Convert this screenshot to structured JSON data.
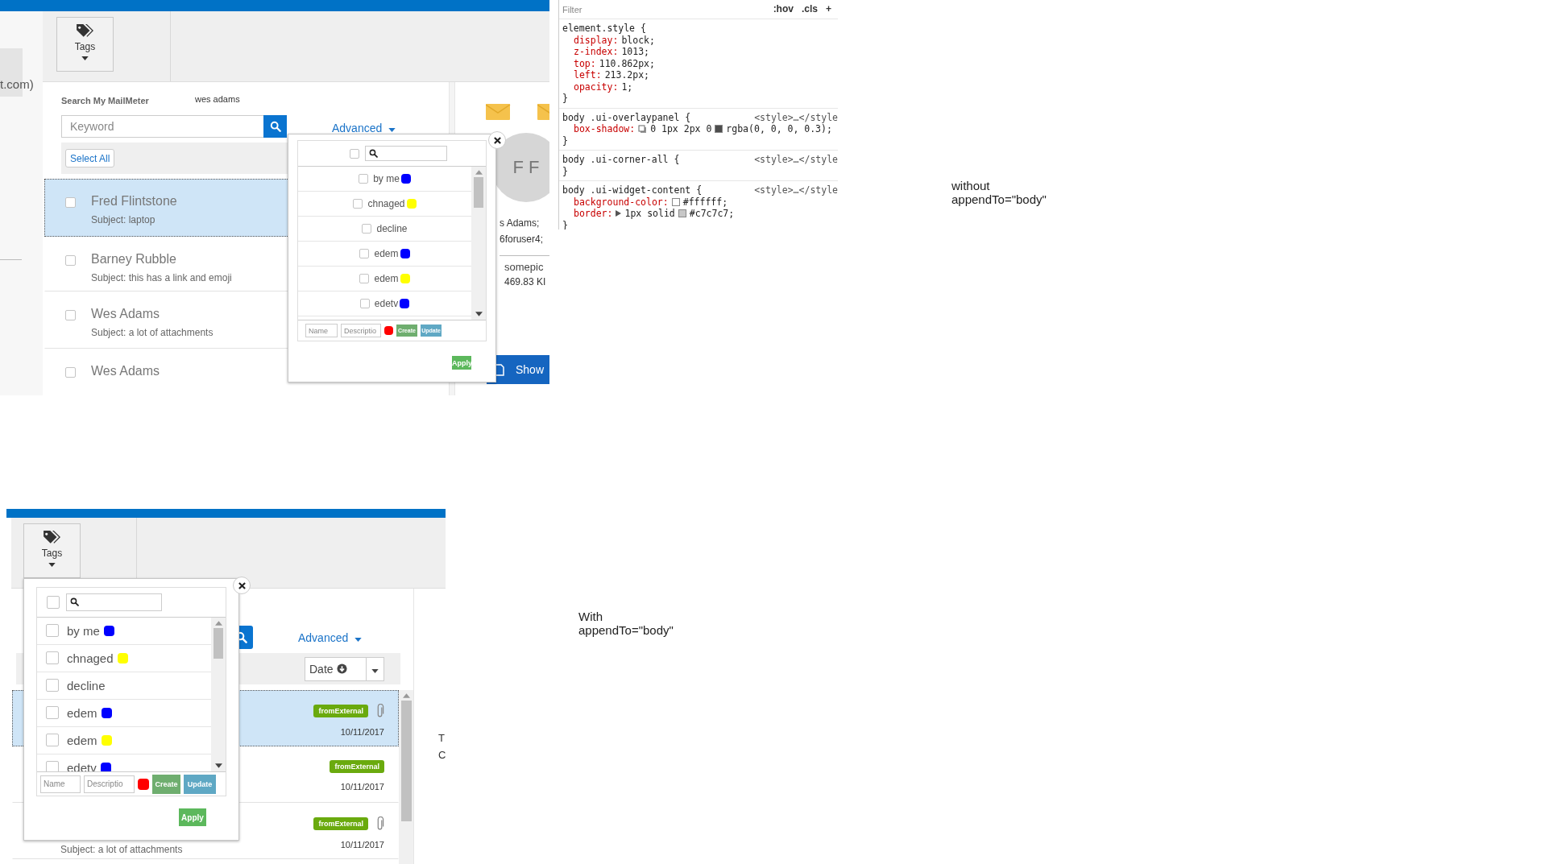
{
  "top_screenshot": {
    "left_strip": {
      "text": "t.com)"
    },
    "toolbar": {
      "tags_button": {
        "label": "Tags"
      }
    },
    "search": {
      "title": "Search My MailMeter",
      "query": "wes adams",
      "placeholder": "Keyword",
      "advanced": "Advanced",
      "select_all": "Select All"
    },
    "messages": [
      {
        "sender": "Fred Flintstone",
        "subject": "Subject: laptop",
        "selected": true,
        "checked": false
      },
      {
        "sender": "Barney Rubble",
        "subject": "Subject: this has a link and emoji",
        "selected": false,
        "checked": false
      },
      {
        "sender": "Wes Adams",
        "subject": "Subject: a lot of attachments",
        "selected": false,
        "checked": false
      },
      {
        "sender": "Wes Adams",
        "selected": false,
        "checked": false
      }
    ],
    "preview": {
      "avatar": "F F",
      "recipients": [
        "s Adams;",
        "6foruser4;"
      ],
      "attachment_name": "somepic",
      "attachment_size": "469.83 KI",
      "show_button": "Show"
    },
    "tag_popup": {
      "all_checked": false,
      "tags": [
        {
          "label": "by me",
          "color": "#0000ff",
          "checked": false
        },
        {
          "label": "chnaged",
          "color": "#ffff00",
          "checked": false
        },
        {
          "label": "decline",
          "checked": false
        },
        {
          "label": "edem",
          "color": "#0000ff",
          "checked": false
        },
        {
          "label": "edem",
          "color": "#ffff00",
          "checked": false
        },
        {
          "label": "edetv",
          "color": "#0000ff",
          "checked": false
        }
      ],
      "name_placeholder": "Name",
      "description_placeholder": "Descriptio",
      "color_picker": {
        "color": "#ff0000"
      },
      "create": {
        "label": "Create",
        "disabled": true
      },
      "update": {
        "label": "Update",
        "disabled": true
      },
      "apply": "Apply"
    }
  },
  "devtools": {
    "filter_placeholder": "Filter",
    "buttons": [
      ":hov",
      ".cls",
      "+"
    ],
    "rules": [
      {
        "selector": "element.style {",
        "declarations": [
          {
            "property": "display:",
            "value": [
              {
                "kind": "text",
                "text": "block;"
              }
            ]
          },
          {
            "property": "z-index:",
            "value": [
              {
                "kind": "text",
                "text": "1013;"
              }
            ]
          },
          {
            "property": "top:",
            "value": [
              {
                "kind": "text",
                "text": "110.862px;"
              }
            ]
          },
          {
            "property": "left:",
            "value": [
              {
                "kind": "text",
                "text": "213.2px;"
              }
            ]
          },
          {
            "property": "opacity:",
            "value": [
              {
                "kind": "text",
                "text": "1;"
              }
            ]
          }
        ],
        "close": "}"
      },
      {
        "selector": "body .ui-overlaypanel {",
        "source": "<style>…</style",
        "declarations": [
          {
            "property": "box-shadow:",
            "value": [
              {
                "kind": "shadow"
              },
              {
                "kind": "text",
                "text": "0 1px 2px 0"
              },
              {
                "kind": "swatch",
                "color": "#4d4d4d"
              },
              {
                "kind": "text",
                "text": "rgba(0, 0, 0, 0.3);"
              }
            ]
          }
        ],
        "close": "}"
      },
      {
        "selector": "body .ui-corner-all {",
        "source": "<style>…</style",
        "close": "}"
      },
      {
        "selector": "body .ui-widget-content {",
        "source": "<style>…</style",
        "declarations": [
          {
            "property": "background-color:",
            "value": [
              {
                "kind": "swatch",
                "color": "#ffffff"
              },
              {
                "kind": "text",
                "text": "#ffffff;"
              }
            ]
          },
          {
            "property": "border:",
            "value": [
              {
                "kind": "expand"
              },
              {
                "kind": "text",
                "text": "1px solid"
              },
              {
                "kind": "swatch",
                "color": "#c7c7c7"
              },
              {
                "kind": "text",
                "text": "#c7c7c7;"
              }
            ]
          }
        ],
        "close": "}"
      }
    ]
  },
  "notes": [
    {
      "text": "without\nappendTo=\"body\""
    },
    {
      "text": "With\nappendTo=\"body\""
    }
  ],
  "bottom_screenshot": {
    "toolbar": {
      "tags_button": {
        "label": "Tags"
      }
    },
    "advanced": "Advanced",
    "sort": {
      "label": "Date"
    },
    "messages": [
      {
        "badge": "fromExternal",
        "attachment": true,
        "date": "10/11/2017",
        "selected": true
      },
      {
        "badge": "fromExternal",
        "attachment": false,
        "date": "10/11/2017",
        "selected": false
      },
      {
        "badge": "fromExternal",
        "attachment": true,
        "date": "10/11/2017",
        "subject": "Subject: a lot of attachments",
        "selected": false
      }
    ],
    "side_text": [
      "T",
      "C"
    ],
    "tag_popup": {
      "all_checked": false,
      "tags": [
        {
          "label": "by me",
          "color": "#0000ff",
          "checked": false
        },
        {
          "label": "chnaged",
          "color": "#ffff00",
          "checked": false
        },
        {
          "label": "decline",
          "checked": false
        },
        {
          "label": "edem",
          "color": "#0000ff",
          "checked": false
        },
        {
          "label": "edem",
          "color": "#ffff00",
          "checked": false
        },
        {
          "label": "edetv",
          "color": "#0000ff",
          "checked": false
        }
      ],
      "name_placeholder": "Name",
      "description_placeholder": "Descriptio",
      "color_picker": {
        "color": "#ff0000"
      },
      "create": {
        "label": "Create",
        "disabled": true
      },
      "update": {
        "label": "Update",
        "disabled": true
      },
      "apply": "Apply"
    }
  }
}
